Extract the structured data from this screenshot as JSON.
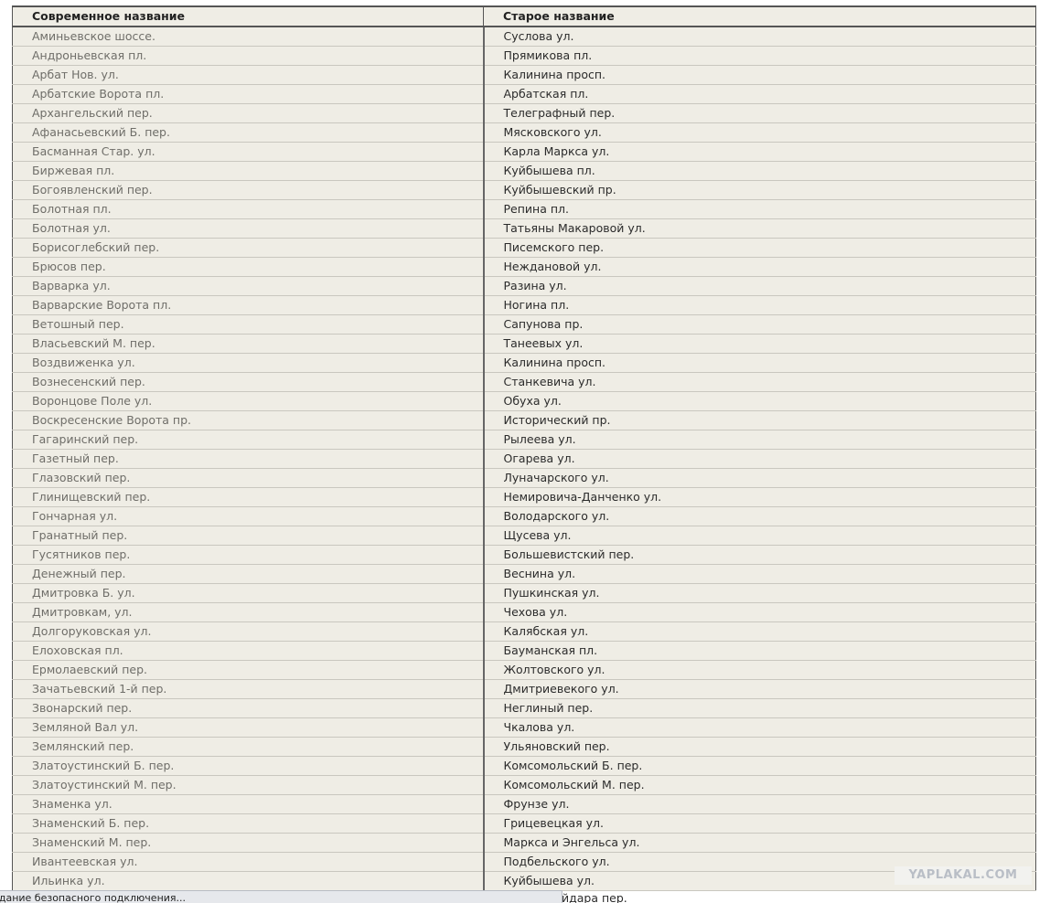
{
  "table": {
    "headers": [
      "Современное название",
      "Старое название"
    ],
    "rows": [
      [
        "Аминьевское шоссе.",
        "Суслова ул."
      ],
      [
        "Андроньевская пл.",
        "Прямикова пл."
      ],
      [
        "Арбат Нов. ул.",
        "Калинина просп."
      ],
      [
        "Арбатские Ворота пл.",
        "Арбатская пл."
      ],
      [
        "Архангельский пер.",
        "Телеграфный пер."
      ],
      [
        "Афанасьевский Б. пер.",
        "Мясковского ул."
      ],
      [
        "Басманная Стар. ул.",
        "Карла Маркса ул."
      ],
      [
        "Биржевая пл.",
        "Куйбышева пл."
      ],
      [
        "Богоявленский пер.",
        "Куйбышевский пр."
      ],
      [
        "Болотная пл.",
        "Репина пл."
      ],
      [
        "Болотная ул.",
        "Татьяны Макаровой ул."
      ],
      [
        "Борисоглебский пер.",
        "Писемского пер."
      ],
      [
        "Брюсов пер.",
        "Неждановой ул."
      ],
      [
        "Варварка ул.",
        "Разина ул."
      ],
      [
        "Варварские Ворота пл.",
        "Ногина пл."
      ],
      [
        "Ветошный пер.",
        "Сапунова пр."
      ],
      [
        "Власьевский М. пер.",
        "Танеевых ул."
      ],
      [
        "Воздвиженка ул.",
        "Калинина просп."
      ],
      [
        "Вознесенский пер.",
        "Станкевича ул."
      ],
      [
        "Воронцове Поле ул.",
        "Обуха ул."
      ],
      [
        "Воскресенские Ворота пр.",
        "Исторический пр."
      ],
      [
        "Гагаринский пер.",
        "Рылеева ул."
      ],
      [
        "Газетный пер.",
        "Огарева ул."
      ],
      [
        "Глазовский пер.",
        "Луначарского ул."
      ],
      [
        "Глинищевский пер.",
        "Немировича-Данченко ул."
      ],
      [
        "Гончарная ул.",
        "Володарского ул."
      ],
      [
        "Гранатный пер.",
        "Щусева ул."
      ],
      [
        "Гусятников пер.",
        "Большевистский пер."
      ],
      [
        "Денежный пер.",
        "Веснина ул."
      ],
      [
        "Дмитровка Б. ул.",
        "Пушкинская ул."
      ],
      [
        "Дмитровкам, ул.",
        "Чехова ул."
      ],
      [
        "Долгоруковская ул.",
        "Калябская ул."
      ],
      [
        "Елоховская пл.",
        "Бауманская пл."
      ],
      [
        "Ермолаевский пер.",
        "Жолтовского ул."
      ],
      [
        "Зачатьевский 1-й пер.",
        "Дмитриевекого ул."
      ],
      [
        "Звонарский пер.",
        "Неглиный пер."
      ],
      [
        "Земляной Вал ул.",
        "Чкалова ул."
      ],
      [
        "Землянский пер.",
        "Ульяновский пер."
      ],
      [
        "Златоустинский Б. пер.",
        "Комсомольский Б. пер."
      ],
      [
        "Златоустинский М. пер.",
        "Комсомольский М. пер."
      ],
      [
        "Знаменка ул.",
        "Фрунзе ул."
      ],
      [
        "Знаменский Б. пер.",
        "Грицевецкая ул."
      ],
      [
        "Знаменский М. пер.",
        "Маркса и Энгельса ул."
      ],
      [
        "Ивантеевская ул.",
        "Подбельского ул."
      ],
      [
        "Ильинка ул.",
        "Куйбышева ул."
      ]
    ],
    "partial_cell": "йдара пер."
  },
  "watermark": {
    "text": "YAPLAKAL.COM"
  },
  "statusbar": {
    "text": "здание безопасного подключения..."
  }
}
